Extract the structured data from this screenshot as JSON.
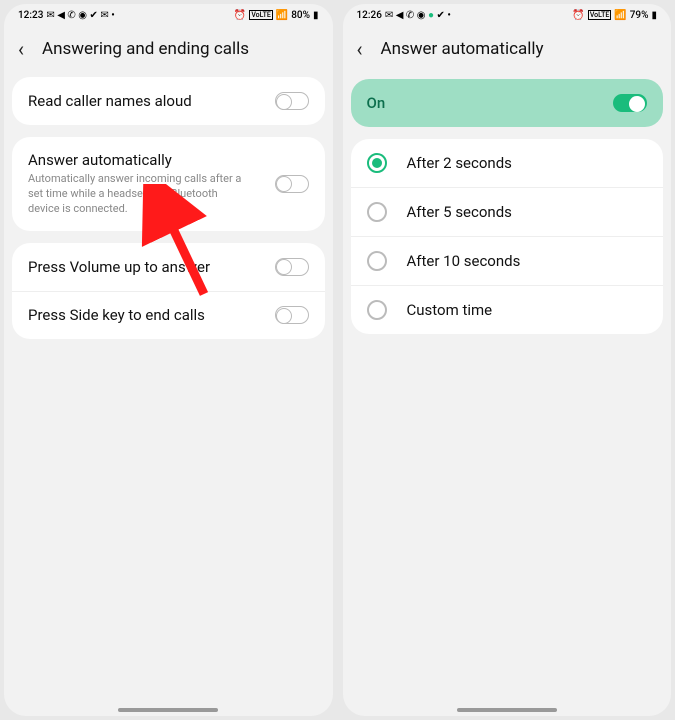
{
  "left": {
    "status": {
      "time": "12:23",
      "icons_left": "✉ ◀ ✆ ◎ ✔ ✉ •",
      "icons_right": "⏰ ᵛᵒ ᴸᵀᴱ ▮◧ 80% ▮",
      "battery": "80%"
    },
    "header": {
      "title": "Answering and ending calls"
    },
    "card1": {
      "read_aloud": "Read caller names aloud"
    },
    "card2": {
      "answer_auto_title": "Answer automatically",
      "answer_auto_sub": "Automatically answer incoming calls after a set time while a headset or a Bluetooth device is connected."
    },
    "card3": {
      "volume_up": "Press Volume up to answer",
      "side_key": "Press Side key to end calls"
    }
  },
  "right": {
    "status": {
      "time": "12:26",
      "icons_left": "✉ ◀ ✆ ◎ ● ✔ •",
      "icons_right": "⏰ ᵛᵒ ᴸᵀᴱ ▮◧ 79% ▮",
      "battery": "79%"
    },
    "header": {
      "title": "Answer automatically"
    },
    "master": {
      "label": "On"
    },
    "options": {
      "o1": "After 2 seconds",
      "o2": "After 5 seconds",
      "o3": "After 10 seconds",
      "o4": "Custom time"
    }
  },
  "annotation": {
    "color": "#ff1a1a"
  }
}
